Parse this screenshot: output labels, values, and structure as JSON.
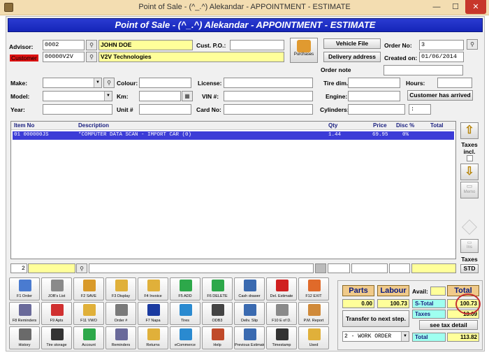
{
  "window": {
    "title": "Point of Sale - (^_.^) Alekandar - APPOINTMENT - ESTIMATE",
    "min": "—",
    "max": "☐",
    "close": "✕"
  },
  "banner": "Point of Sale - (^_.^) Alekandar - APPOINTMENT - ESTIMATE",
  "header": {
    "advisor_label": "Advisor:",
    "advisor_code": "0002",
    "advisor_name": "JOHN DOE",
    "customer_label": "Customer",
    "customer_code": "00000V2V",
    "customer_name": "V2V Technologies",
    "cust_po_label": "Cust. P.O.:",
    "cust_po": "",
    "purchases_label": "Purchases",
    "vehicle_file": "Vehicle File",
    "delivery_address": "Delivery address",
    "order_no_label": "Order No:",
    "order_no": "3",
    "created_on_label": "Created on:",
    "created_on": "01/06/2014",
    "order_note_label": "Order note",
    "order_note": ""
  },
  "vehicle": {
    "make_label": "Make:",
    "model_label": "Model:",
    "year_label": "Year:",
    "colour_label": "Colour:",
    "km_label": "Km:",
    "unit_label": "Unit #",
    "license_label": "License:",
    "vin_label": "VIN #:",
    "card_label": "Card No:",
    "tire_dim_label": "Tire dim.",
    "engine_label": "Engine:",
    "cylinders_label": "Cylinders:",
    "hours_label": "Hours:",
    "customer_arrived": "Customer has arrived",
    "cylinders_value": ":"
  },
  "grid": {
    "columns": [
      "Item No",
      "Description",
      "Qty",
      "Price",
      "Disc %",
      "Total"
    ],
    "rows": [
      {
        "item_no": "01  000000JS",
        "description": "*COMPUTER DATA SCAN - IMPORT CAR (0)",
        "qty": "1.44",
        "price": "69.95",
        "disc": "0%",
        "total": ""
      }
    ]
  },
  "side": {
    "taxes_incl": "Taxes incl.",
    "memo": "Memo",
    "ins": "Ins",
    "taxes": "Taxes",
    "std": "STD"
  },
  "bottom_row": {
    "qty": "2"
  },
  "toolbar": [
    {
      "label": "F1 Order",
      "icon": "order-icon",
      "color": "#4a7bd0"
    },
    {
      "label": "JOB's List",
      "icon": "tools-icon",
      "color": "#8a8a8a"
    },
    {
      "label": "F2 SAVE",
      "icon": "save-icon",
      "color": "#d99a2a"
    },
    {
      "label": "F3 Display",
      "icon": "folder-icon",
      "color": "#e0b03a"
    },
    {
      "label": "F4 Invoice",
      "icon": "invoice-icon",
      "color": "#e0b03a"
    },
    {
      "label": "F5 ADD",
      "icon": "plus-icon",
      "color": "#2da84a"
    },
    {
      "label": "F6 DELETE",
      "icon": "minus-icon",
      "color": "#2da84a"
    },
    {
      "label": "Cash drawer",
      "icon": "cash-drawer-icon",
      "color": "#3a6ab0"
    },
    {
      "label": "Del. Estimate",
      "icon": "delete-x-icon",
      "color": "#d02020"
    },
    {
      "label": "F12 EXIT",
      "icon": "exit-icon",
      "color": "#e06a2a"
    },
    {
      "label": "F8 Reminders",
      "icon": "reminders-icon",
      "color": "#6a6a9a"
    },
    {
      "label": "F9 Apts",
      "icon": "calendar-icon",
      "color": "#d03030"
    },
    {
      "label": "F11 VWO",
      "icon": "vwo-icon",
      "color": "#e0b03a"
    },
    {
      "label": "Order #",
      "icon": "gear-icon",
      "color": "#7a7a7a"
    },
    {
      "label": "F7 Napa",
      "icon": "napa-icon",
      "color": "#1a3aa0"
    },
    {
      "label": "Tires",
      "icon": "globe-icon",
      "color": "#2a8ad0"
    },
    {
      "label": "ODB3",
      "icon": "obd3-icon",
      "color": "#444444"
    },
    {
      "label": "Deliv. Slip",
      "icon": "delivery-slip-icon",
      "color": "#3a6ab0"
    },
    {
      "label": "F10 E of D.",
      "icon": "end-of-day-icon",
      "color": "#8a8a8a"
    },
    {
      "label": "P.M. Report",
      "icon": "report-icon",
      "color": "#d08a3a"
    },
    {
      "label": "History",
      "icon": "history-icon",
      "color": "#6a6a6a"
    },
    {
      "label": "Tire storage",
      "icon": "tire-storage-icon",
      "color": "#333333"
    },
    {
      "label": "Account",
      "icon": "dollar-icon",
      "color": "#2da84a"
    },
    {
      "label": "Reminders",
      "icon": "reminders-list-icon",
      "color": "#6a6a9a"
    },
    {
      "label": "Returns",
      "icon": "returns-icon",
      "color": "#e0b03a"
    },
    {
      "label": "eCommerce",
      "icon": "ecommerce-icon",
      "color": "#2a8ad0"
    },
    {
      "label": "Help",
      "icon": "help-icon",
      "color": "#c04a2a"
    },
    {
      "label": "Previous Estimate",
      "icon": "previous-estimate-icon",
      "color": "#3a6ab0"
    },
    {
      "label": "Timestamp",
      "icon": "scanner-icon",
      "color": "#333333"
    },
    {
      "label": "Used",
      "icon": "used-icon",
      "color": "#e0b03a"
    }
  ],
  "totals": {
    "parts_label": "Parts",
    "labour_label": "Labour",
    "avail_label": "Avail:",
    "total_label": "Total",
    "parts_value": "0.00",
    "labour_value": "100.73",
    "stotal_label": "S-Total",
    "stotal_value": "100.73",
    "taxes_label": "Taxes",
    "taxes_value": "13.09",
    "transfer": "Transfer to next step.",
    "see_tax_detail": "see tax detail",
    "status": "2 - WORK ORDER",
    "grand_total_label": "Total",
    "grand_total_value": "113.82"
  }
}
